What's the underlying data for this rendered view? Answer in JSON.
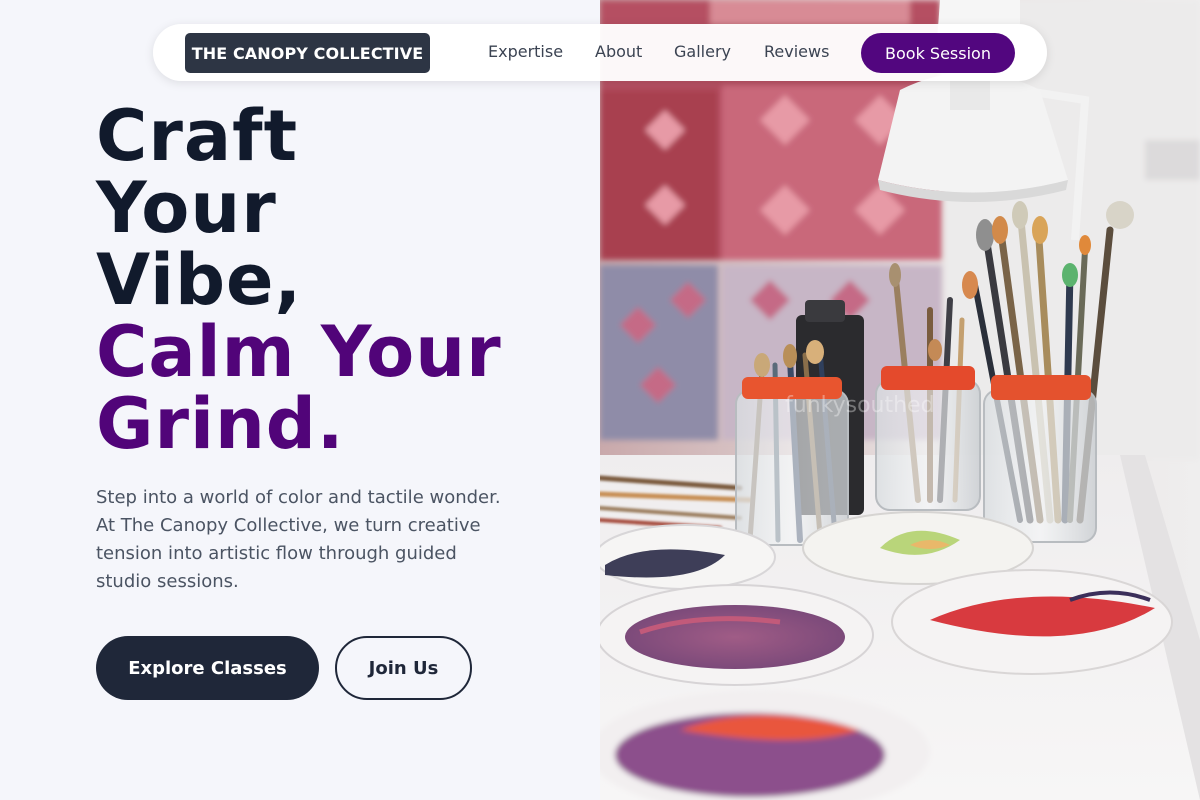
{
  "nav": {
    "logo": "THE CANOPY COLLECTIVE",
    "links": [
      "Expertise",
      "About",
      "Gallery",
      "Reviews"
    ],
    "cta": "Book Session"
  },
  "hero": {
    "headline_lines": [
      "Craft",
      "Your",
      "Vibe,"
    ],
    "headline_accent_lines": [
      "Calm Your",
      "Grind."
    ],
    "description": "Step into a world of color and tactile wonder. At The Canopy Collective, we turn creative tension into artistic flow through guided studio sessions.",
    "primary_button": "Explore Classes",
    "secondary_button": "Join Us"
  },
  "image": {
    "subject": "art studio with paintbrush jars and paint palettes",
    "watermark": "funkysouthed"
  },
  "colors": {
    "accent": "#52067f",
    "dark": "#1f2739",
    "background": "#f5f6fb"
  }
}
